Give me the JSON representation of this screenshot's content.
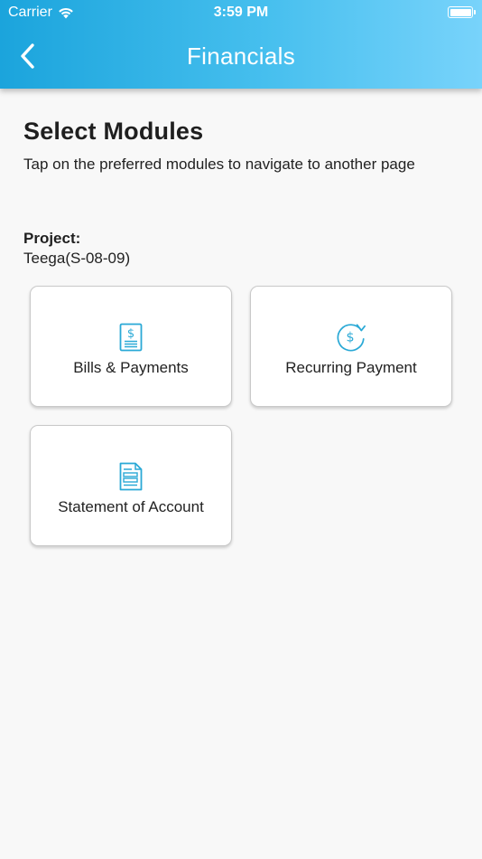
{
  "status_bar": {
    "carrier": "Carrier",
    "time": "3:59 PM"
  },
  "nav": {
    "title": "Financials"
  },
  "main": {
    "title": "Select Modules",
    "subtitle": "Tap on the preferred modules to navigate to another page",
    "project_label": "Project:",
    "project_value": "Teega(S-08-09)",
    "modules": [
      {
        "label": "Bills & Payments",
        "icon": "bill-dollar-icon"
      },
      {
        "label": "Recurring Payment",
        "icon": "recurring-dollar-icon"
      },
      {
        "label": "Statement of Account",
        "icon": "statement-document-icon"
      }
    ]
  },
  "colors": {
    "header_start": "#1ba4dc",
    "header_end": "#78d3fb",
    "icon_accent": "#2aa9d6",
    "background": "#f8f8f8"
  }
}
